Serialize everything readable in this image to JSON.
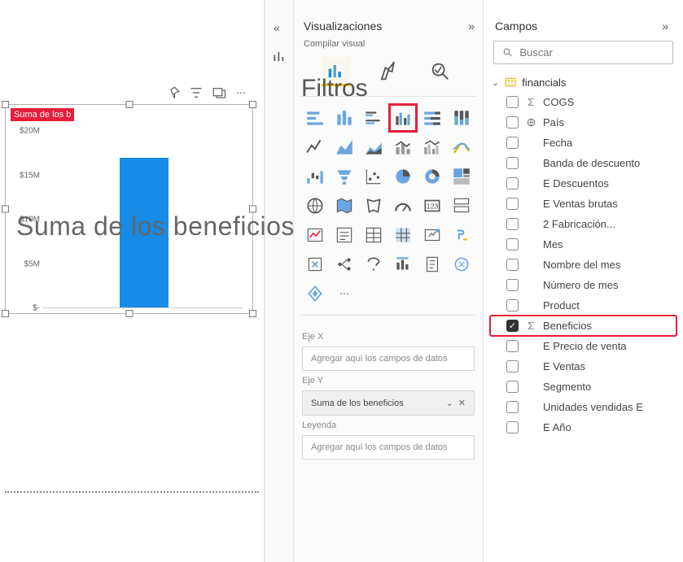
{
  "overlay": {
    "filtros": "Filtros",
    "suma": "Suma de los beneficios"
  },
  "canvas": {
    "visual_title": "Suma de los b",
    "y_ticks": [
      "$20M",
      "$15M",
      "$10M",
      "$5M",
      "$-"
    ]
  },
  "chart_data": {
    "type": "bar",
    "categories": [
      ""
    ],
    "values": [
      17000000
    ],
    "title": "Suma de los beneficios",
    "xlabel": "",
    "ylabel": "",
    "ylim": [
      0,
      20000000
    ]
  },
  "viz": {
    "header": "Visualizaciones",
    "sub": "Compilar visual",
    "x_label": "Eje X",
    "x_placeholder": "Agregar aquí los campos de datos",
    "y_label": "Eje Y",
    "y_value": "Suma de los beneficios",
    "legend_label": "Leyenda",
    "legend_placeholder": "Agregar aquí los campos de datos"
  },
  "fields": {
    "header": "Campos",
    "search_placeholder": "Buscar",
    "table": "financials",
    "items": [
      {
        "name": "COGS",
        "icon": "sigma",
        "checked": false
      },
      {
        "name": "País",
        "icon": "globe",
        "checked": false
      },
      {
        "name": "Fecha",
        "icon": "",
        "checked": false
      },
      {
        "name": "Banda de descuento",
        "icon": "",
        "checked": false
      },
      {
        "name": "E Descuentos",
        "icon": "",
        "checked": false
      },
      {
        "name": "E Ventas brutas",
        "icon": "",
        "checked": false
      },
      {
        "name": "2 Fabricación...",
        "icon": "",
        "checked": false
      },
      {
        "name": "Mes",
        "icon": "",
        "checked": false
      },
      {
        "name": "Nombre del mes",
        "icon": "",
        "checked": false
      },
      {
        "name": "Número de mes",
        "icon": "",
        "checked": false
      },
      {
        "name": "Product",
        "icon": "",
        "checked": false
      },
      {
        "name": "Beneficios",
        "icon": "sigma",
        "checked": true,
        "hl": true
      },
      {
        "name": "E Precio de venta",
        "icon": "",
        "checked": false
      },
      {
        "name": "E Ventas",
        "icon": "",
        "checked": false
      },
      {
        "name": "Segmento",
        "icon": "",
        "checked": false
      },
      {
        "name": "Unidades vendidas E",
        "icon": "",
        "checked": false
      },
      {
        "name": "E Año",
        "icon": "",
        "checked": false
      }
    ]
  }
}
